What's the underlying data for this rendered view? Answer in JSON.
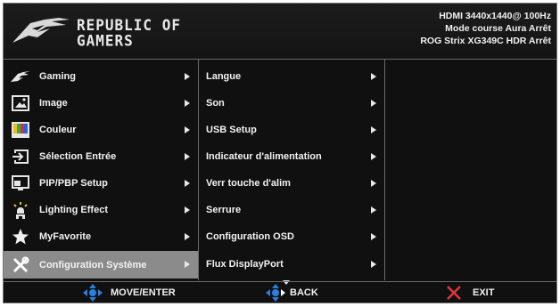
{
  "brand": {
    "line1": "REPUBLIC OF",
    "line2": "GAMERS"
  },
  "status": {
    "line1": "HDMI  3440x1440@  100Hz",
    "line2": "Mode course  Aura Arrêt",
    "line3": "ROG Strix XG349C  HDR Arrêt"
  },
  "main_menu": [
    {
      "label": "Gaming",
      "icon": "rog-eye-icon"
    },
    {
      "label": "Image",
      "icon": "image-icon"
    },
    {
      "label": "Couleur",
      "icon": "color-bars-icon"
    },
    {
      "label": "Sélection Entrée",
      "icon": "input-icon"
    },
    {
      "label": "PIP/PBP Setup",
      "icon": "pip-icon"
    },
    {
      "label": "Lighting Effect",
      "icon": "lighting-icon"
    },
    {
      "label": "MyFavorite",
      "icon": "star-icon"
    },
    {
      "label": "Configuration Système",
      "icon": "tools-icon",
      "selected": true
    }
  ],
  "sub_menu": [
    {
      "label": "Langue"
    },
    {
      "label": "Son"
    },
    {
      "label": "USB Setup"
    },
    {
      "label": "Indicateur d'alimentation"
    },
    {
      "label": "Verr touche d'alim"
    },
    {
      "label": "Serrure"
    },
    {
      "label": "Configuration OSD"
    },
    {
      "label": "Flux DisplayPort"
    }
  ],
  "footer": {
    "move_enter": "MOVE/ENTER",
    "back": "BACK",
    "exit": "EXIT"
  },
  "colors": {
    "accent_blue": "#2a7fe0",
    "exit_red": "#e03838",
    "selected_bg": "#8b8b8b"
  }
}
